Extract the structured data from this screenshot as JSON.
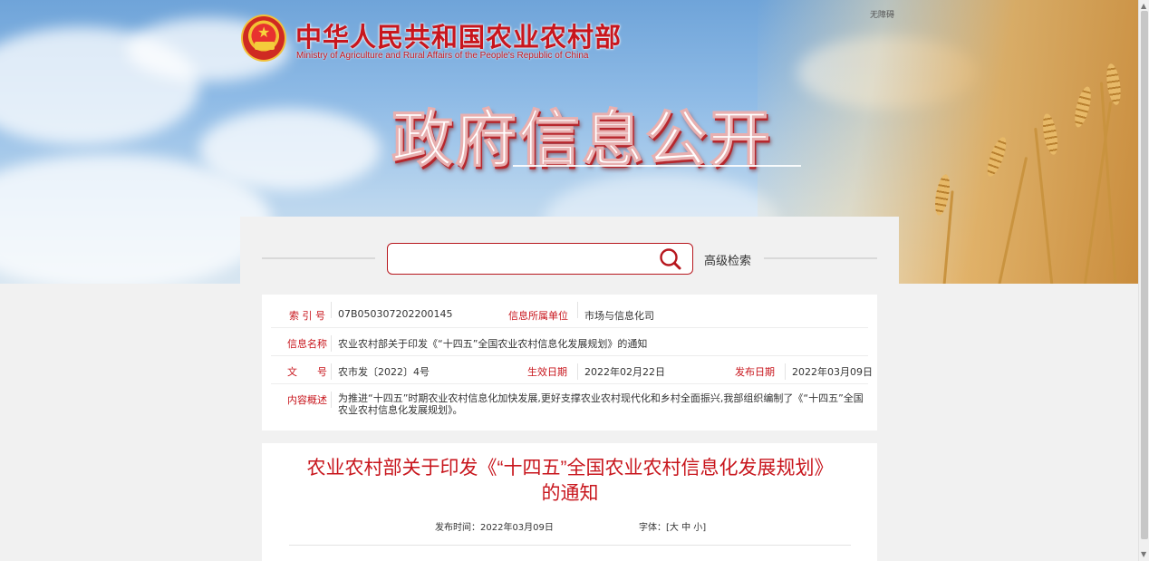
{
  "header": {
    "ministry_cn": "中华人民共和国农业农村部",
    "ministry_en": "Ministry of Agriculture and Rural Affairs of the People's Republic of China",
    "accessibility": "无障碍",
    "section_title": "政府信息公开"
  },
  "search": {
    "placeholder": "",
    "value": "",
    "advanced_label": "高级检索",
    "icon": "search-icon"
  },
  "info": {
    "index_label": "索 引 号",
    "index_value": "07B050307202200145",
    "dept_label": "信息所属单位",
    "dept_value": "市场与信息化司",
    "name_label": "信息名称",
    "name_value": "农业农村部关于印发《“十四五”全国农业农村信息化发展规划》的通知",
    "doc_label": "文　　号",
    "doc_value": "农市发〔2022〕4号",
    "effective_label": "生效日期",
    "effective_value": "2022年02月22日",
    "publish_label": "发布日期",
    "publish_value": "2022年03月09日",
    "summary_label": "内容概述",
    "summary_value": "为推进“十四五”时期农业农村信息化加快发展,更好支撑农业农村现代化和乡村全面振兴,我部组织编制了《“十四五”全国农业农村信息化发展规划》。"
  },
  "article": {
    "title_line1": "农业农村部关于印发《“十四五”全国农业农村信息化发展规划》",
    "title_line2": "的通知",
    "publish_time": "发布时间：2022年03月09日",
    "font_size_label": "字体：[大 中 小]"
  },
  "colors": {
    "accent": "#c8161d",
    "panel_bg": "#f1f1f1"
  }
}
